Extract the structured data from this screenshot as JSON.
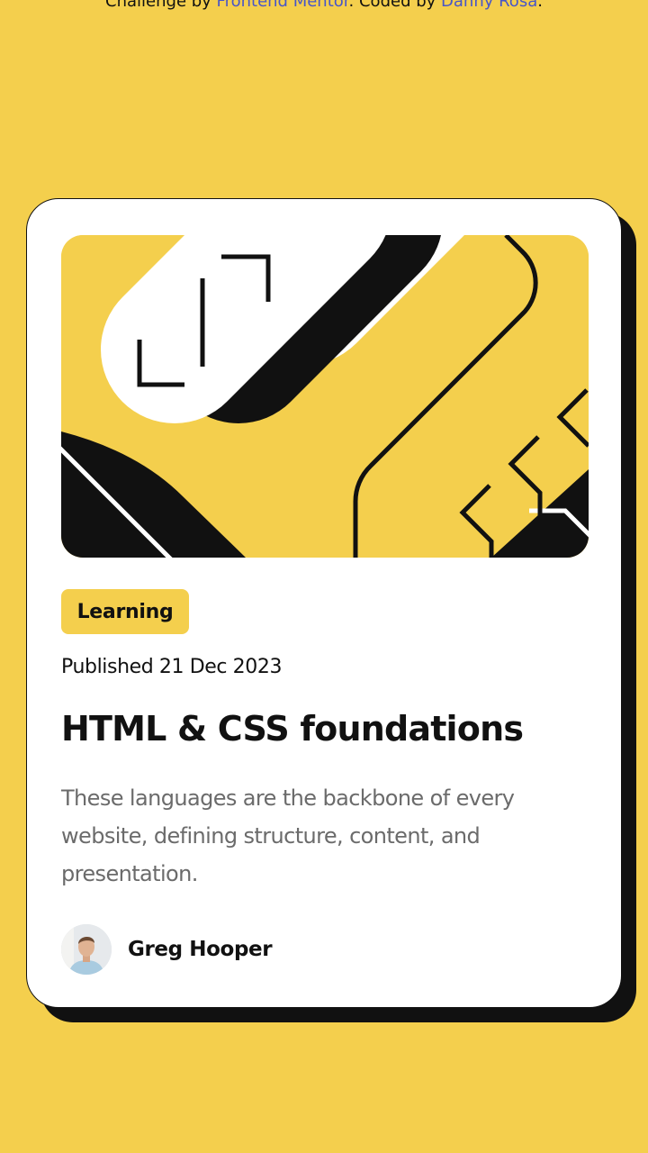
{
  "attribution": {
    "prefix": "Challenge by ",
    "challenge_link": "Frontend Mentor",
    "middle": ". Coded by ",
    "coder_link": "Danny Rosa",
    "suffix": "."
  },
  "card": {
    "tag": "Learning",
    "published": "Published 21 Dec 2023",
    "title": "HTML & CSS foundations",
    "description": "These languages are the backbone of every website, defining structure, content, and presentation.",
    "author": {
      "name": "Greg Hooper"
    }
  },
  "colors": {
    "background": "#F4CF4D",
    "card": "#FFFFFF",
    "ink": "#111111",
    "muted_text": "#6B6B6B",
    "link": "#4856C8"
  },
  "icons": {
    "hero": "abstract-illustration",
    "avatar": "author-photo"
  }
}
